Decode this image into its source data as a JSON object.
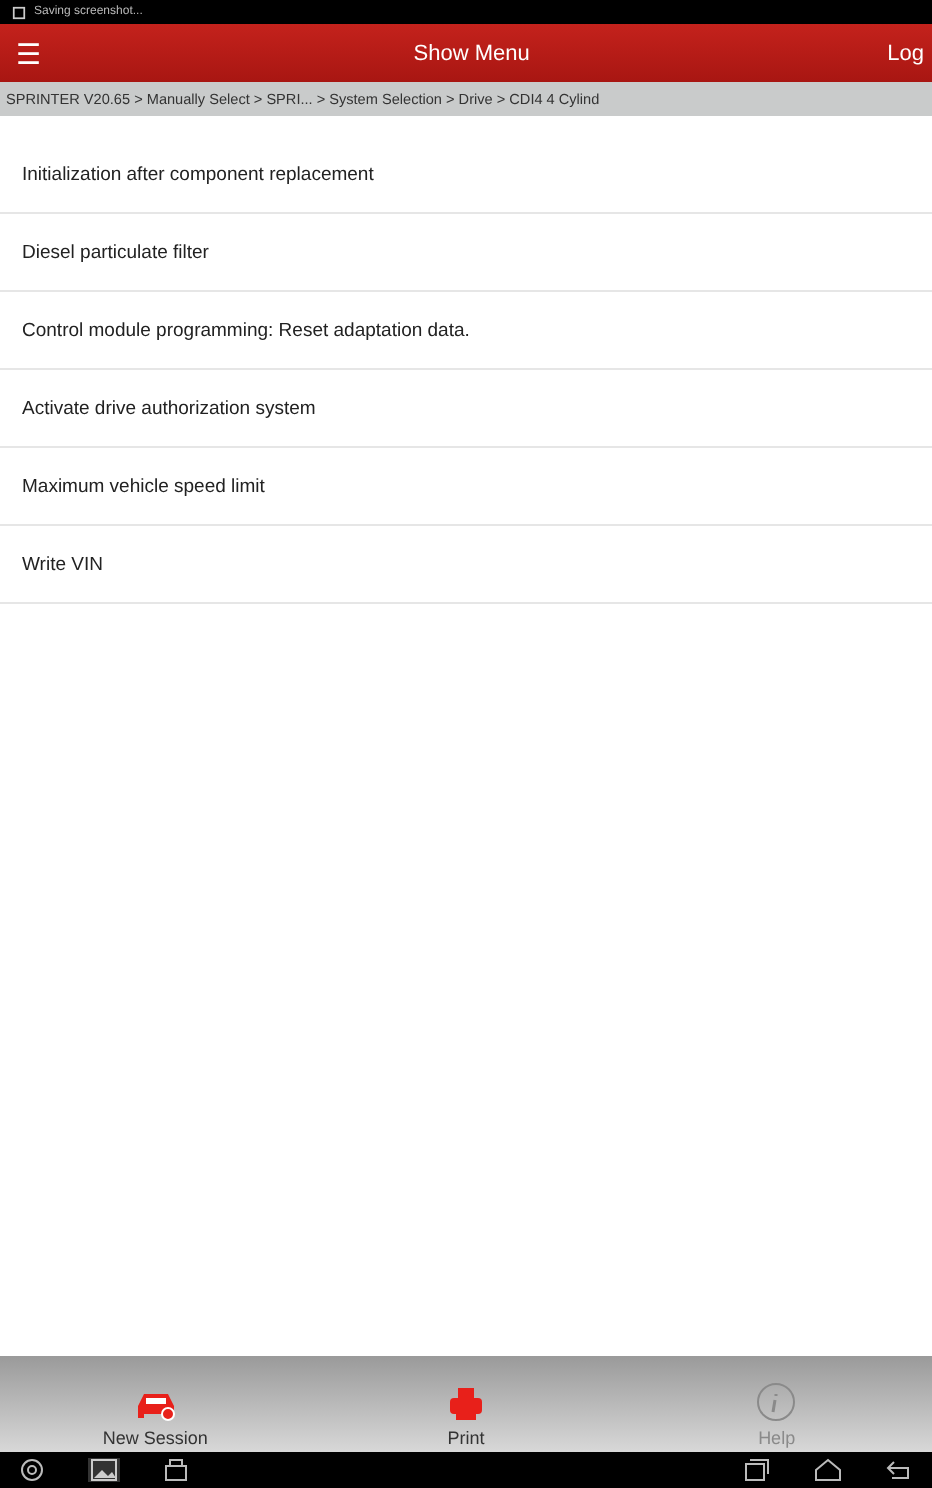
{
  "status_bar": {
    "notification": "Saving screenshot..."
  },
  "header": {
    "menu_icon": "☰",
    "title": "Show Menu",
    "right_label": "Log"
  },
  "breadcrumb": "SPRINTER V20.65 > Manually Select > SPRI... > System Selection > Drive > CDI4 4 Cylind",
  "functions": [
    {
      "label": "Initialization after component replacement"
    },
    {
      "label": "Diesel particulate filter"
    },
    {
      "label": "Control module programming: Reset adaptation data."
    },
    {
      "label": "Activate drive authorization system"
    },
    {
      "label": "Maximum vehicle speed limit"
    },
    {
      "label": "Write VIN"
    }
  ],
  "toolbar": [
    {
      "kind": "car",
      "label": "New Session",
      "disabled": false
    },
    {
      "kind": "print",
      "label": "Print",
      "disabled": false
    },
    {
      "kind": "info",
      "label": "Help",
      "disabled": true
    }
  ]
}
